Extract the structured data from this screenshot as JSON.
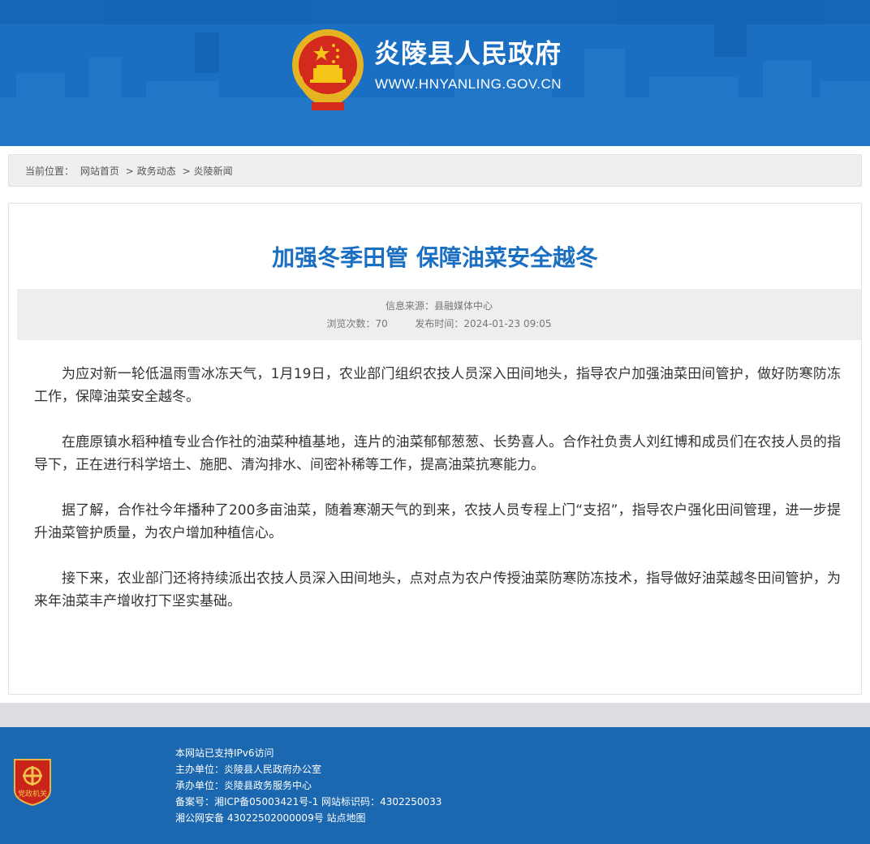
{
  "header": {
    "site_title": "炎陵县人民政府",
    "site_url": "WWW.HNYANLING.GOV.CN",
    "logo_icon": "national-emblem-icon",
    "bg_color": "#1a6fc2"
  },
  "breadcrumb": {
    "prefix": "当前位置：",
    "items": [
      "网站首页",
      "政务动态",
      "炎陵新闻"
    ],
    "separator": ">"
  },
  "article": {
    "title": "加强冬季田管 保障油菜安全越冬",
    "source_label": "信息来源：",
    "source": "县融媒体中心",
    "views_label": "浏览次数：",
    "views": "70",
    "publish_label": "发布时间：",
    "publish_time": "2024-01-23 09:05",
    "paragraphs": [
      "为应对新一轮低温雨雪冰冻天气，1月19日，农业部门组织农技人员深入田间地头，指导农户加强油菜田间管护，做好防寒防冻工作，保障油菜安全越冬。",
      "在鹿原镇水稻种植专业合作社的油菜种植基地，连片的油菜郁郁葱葱、长势喜人。合作社负责人刘红博和成员们在农技人员的指导下，正在进行科学培土、施肥、清沟排水、间密补稀等工作，提高油菜抗寒能力。",
      "据了解，合作社今年播种了200多亩油菜，随着寒潮天气的到来，农技人员专程上门“支招”，指导农户强化田间管理，进一步提升油菜管护质量，为农户增加种植信心。",
      "接下来，农业部门还将持续派出农技人员深入田间地头，点对点为农户传授油菜防寒防冻技术，指导做好油菜越冬田间管护，为来年油菜丰产增收打下坚实基础。"
    ],
    "title_color": "#1a6fc2"
  },
  "footer": {
    "badge_icon": "party-government-badge-icon",
    "badge_text": "党政机关",
    "ipv6": "本网站已支持IPv6访问",
    "host_label": "主办单位：",
    "host": "炎陵县人民政府办公室",
    "operator_label": "承办单位：",
    "operator": "炎陵县政务服务中心",
    "icp_label": "备案号：",
    "icp": "湘ICP备05003421号-1",
    "site_id_label": "网站标识码：",
    "site_id": "4302250033",
    "police": "湘公网安备 43022502000009号",
    "sitemap": "站点地图",
    "bg_color": "#1b67b0"
  }
}
